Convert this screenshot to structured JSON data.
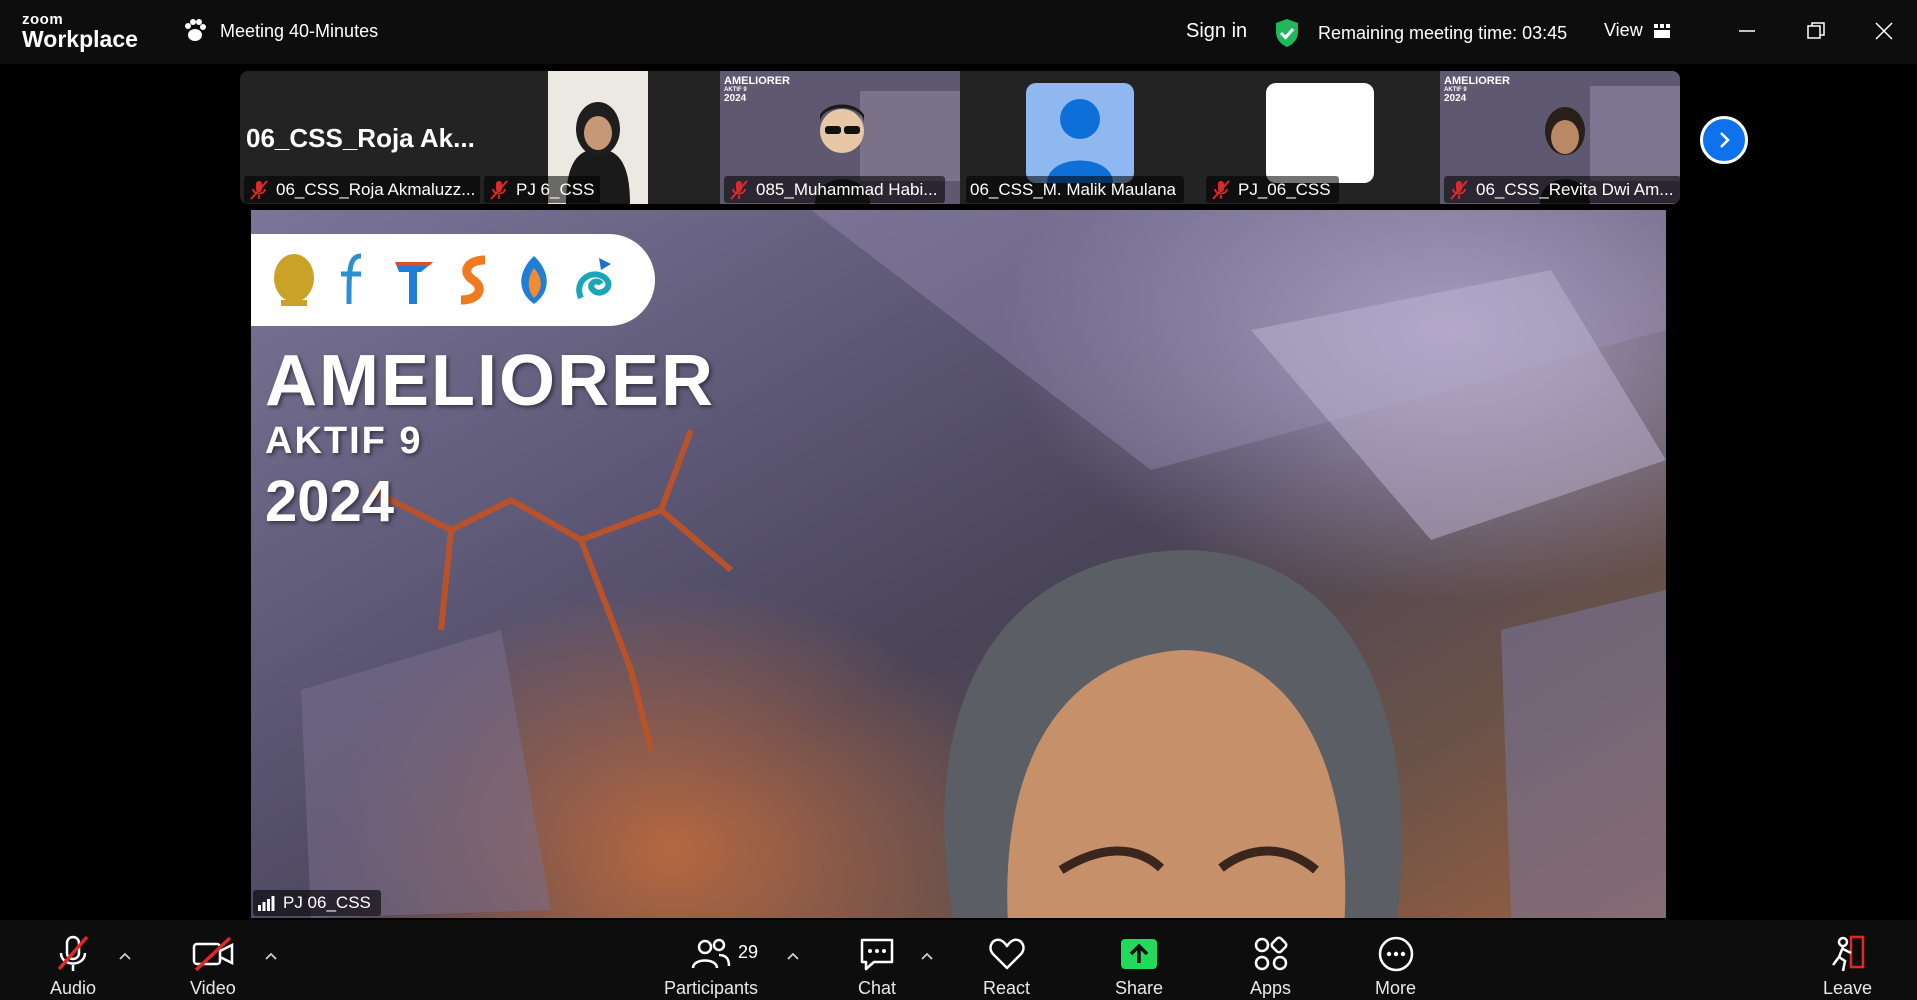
{
  "app": {
    "logo_line1": "zoom",
    "logo_line2": "Workplace"
  },
  "header": {
    "meeting_title": "Meeting 40-Minutes",
    "sign_in": "Sign in",
    "remaining": "Remaining meeting time: 03:45",
    "view": "View"
  },
  "thumbnails": {
    "large_name": "06_CSS_Roja  Ak...",
    "items": [
      {
        "name": "06_CSS_Roja Akmaluzz...",
        "muted": true
      },
      {
        "name": "PJ 6_CSS",
        "muted": true
      },
      {
        "name": "085_Muhammad Habi...",
        "muted": true
      },
      {
        "name": "06_CSS_M. Malik Maulana",
        "muted": false
      },
      {
        "name": "PJ_06_CSS",
        "muted": true
      },
      {
        "name": "06_CSS_Revita Dwi Am...",
        "muted": true
      }
    ],
    "mini_banner": {
      "title": "AMELIORER",
      "sub": "AKTIF 9",
      "year": "2024"
    }
  },
  "main_video": {
    "title": "AMELIORER",
    "subtitle": "AKTIF 9",
    "year": "2024",
    "speaker_label": "PJ 06_CSS"
  },
  "toolbar": {
    "audio": "Audio",
    "video": "Video",
    "participants": "Participants",
    "participants_count": "29",
    "chat": "Chat",
    "react": "React",
    "share": "Share",
    "apps": "Apps",
    "more": "More",
    "leave": "Leave"
  },
  "colors": {
    "accent_blue": "#0e72ed",
    "share_green": "#23d959",
    "shield_green": "#1fb85a",
    "muted_red": "#e02828"
  }
}
